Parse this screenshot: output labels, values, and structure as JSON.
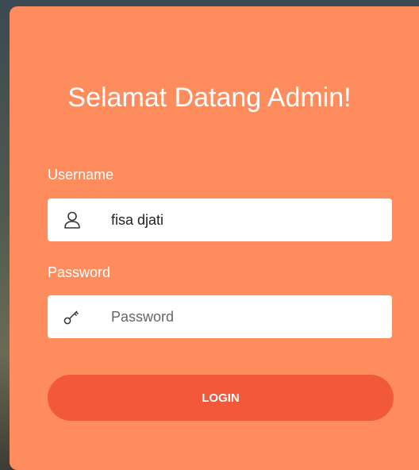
{
  "page": {
    "title": "Selamat Datang Admin!",
    "accent_color": "#ff8c5c",
    "button_color": "#f2593b"
  },
  "username": {
    "label": "Username",
    "value": "fisa djati",
    "icon": "user-icon"
  },
  "password": {
    "label": "Password",
    "placeholder": "Password",
    "icon": "key-icon"
  },
  "login": {
    "label": "LOGIN"
  }
}
